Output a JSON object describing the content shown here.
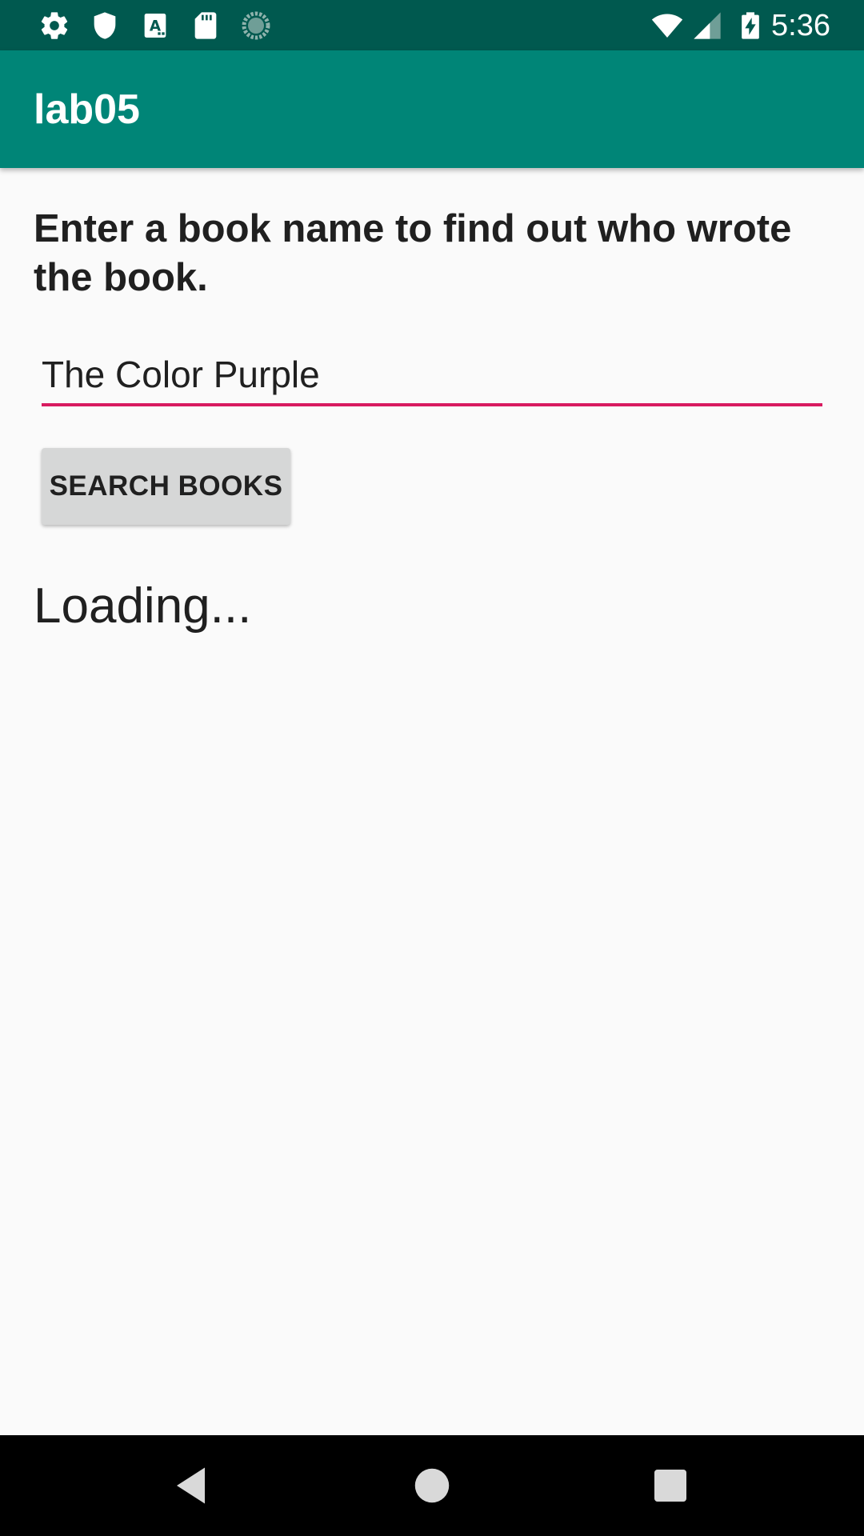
{
  "status_bar": {
    "time": "5:36",
    "left_icons": [
      "gear-icon",
      "shield-icon",
      "text-a-icon",
      "sd-card-icon",
      "loading-circle-icon"
    ],
    "right_icons": [
      "wifi-icon",
      "cell-signal-icon",
      "battery-charging-icon"
    ]
  },
  "app_bar": {
    "title": "lab05",
    "color": "#008577"
  },
  "main": {
    "instructions": "Enter a book name to find out who wrote the book.",
    "book_input": {
      "value": "The Color Purple",
      "accent_color": "#d81b60"
    },
    "search_button_label": "SEARCH BOOKS",
    "result_text": "Loading..."
  },
  "nav_bar": {
    "buttons": [
      "back-icon",
      "home-icon",
      "recents-icon"
    ]
  }
}
